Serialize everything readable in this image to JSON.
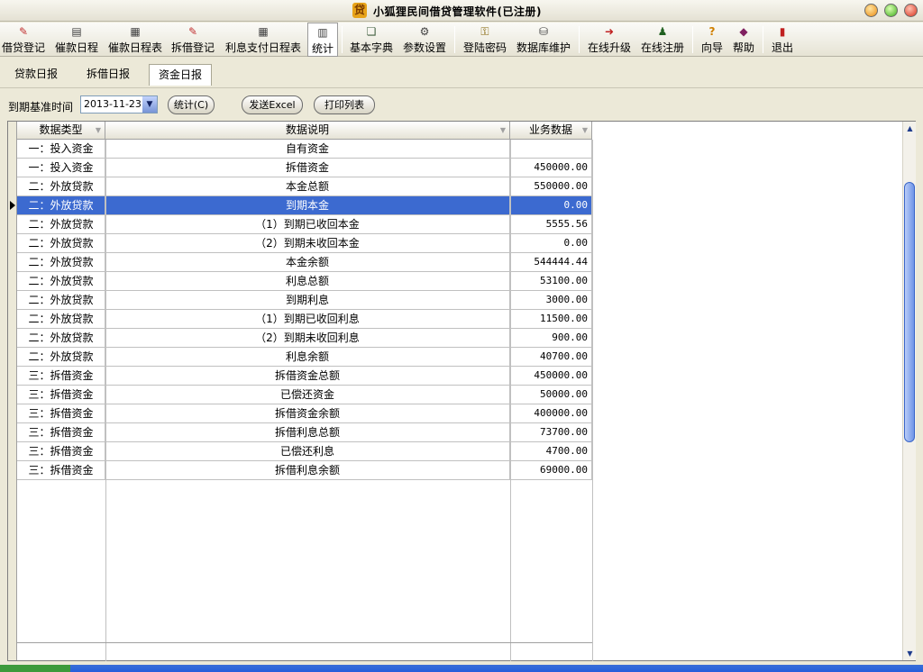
{
  "window": {
    "title": "小狐狸民间借贷管理软件(已注册)"
  },
  "toolbar": {
    "buttons": [
      {
        "label": "借贷登记",
        "icon": "loan-register-icon"
      },
      {
        "label": "催款日程",
        "icon": "calendar-icon"
      },
      {
        "label": "催款日程表",
        "icon": "schedule-table-icon"
      },
      {
        "label": "拆借登记",
        "icon": "borrow-register-icon"
      },
      {
        "label": "利息支付日程表",
        "icon": "interest-table-icon"
      },
      {
        "label": "统计",
        "icon": "statistics-icon"
      },
      {
        "label": "基本字典",
        "icon": "dictionary-icon"
      },
      {
        "label": "参数设置",
        "icon": "settings-icon"
      },
      {
        "label": "登陆密码",
        "icon": "key-icon"
      },
      {
        "label": "数据库维护",
        "icon": "database-icon"
      },
      {
        "label": "在线升级",
        "icon": "upgrade-icon"
      },
      {
        "label": "在线注册",
        "icon": "register-user-icon"
      },
      {
        "label": "向导",
        "icon": "help-question-icon"
      },
      {
        "label": "帮助",
        "icon": "help-book-icon"
      },
      {
        "label": "退出",
        "icon": "exit-icon"
      }
    ]
  },
  "tabs": [
    "贷款日报",
    "拆借日报",
    "资金日报"
  ],
  "filter": {
    "date_label": "到期基准时间",
    "date_value": "2013-11-23",
    "stat_button": "统计(C)",
    "excel_button": "发送Excel",
    "print_button": "打印列表"
  },
  "table": {
    "headers": [
      "数据类型",
      "数据说明",
      "业务数据"
    ],
    "rows": [
      {
        "type": "一：投入资金",
        "desc": "自有资金",
        "value": ""
      },
      {
        "type": "一：投入资金",
        "desc": "拆借资金",
        "value": "450000.00"
      },
      {
        "type": "二：外放贷款",
        "desc": "本金总额",
        "value": "550000.00"
      },
      {
        "type": "二：外放贷款",
        "desc": "到期本金",
        "value": "0.00"
      },
      {
        "type": "二：外放贷款",
        "desc": "（1）到期已收回本金",
        "value": "5555.56"
      },
      {
        "type": "二：外放贷款",
        "desc": "（2）到期未收回本金",
        "value": "0.00"
      },
      {
        "type": "二：外放贷款",
        "desc": "本金余额",
        "value": "544444.44"
      },
      {
        "type": "二：外放贷款",
        "desc": "利息总额",
        "value": "53100.00"
      },
      {
        "type": "二：外放贷款",
        "desc": "到期利息",
        "value": "3000.00"
      },
      {
        "type": "二：外放贷款",
        "desc": "（1）到期已收回利息",
        "value": "11500.00"
      },
      {
        "type": "二：外放贷款",
        "desc": "（2）到期未收回利息",
        "value": "900.00"
      },
      {
        "type": "二：外放贷款",
        "desc": "利息余额",
        "value": "40700.00"
      },
      {
        "type": "三：拆借资金",
        "desc": "拆借资金总额",
        "value": "450000.00"
      },
      {
        "type": "三：拆借资金",
        "desc": "已偿还资金",
        "value": "50000.00"
      },
      {
        "type": "三：拆借资金",
        "desc": "拆借资金余额",
        "value": "400000.00"
      },
      {
        "type": "三：拆借资金",
        "desc": "拆借利息总额",
        "value": "73700.00"
      },
      {
        "type": "三：拆借资金",
        "desc": "已偿还利息",
        "value": "4700.00"
      },
      {
        "type": "三：拆借资金",
        "desc": "拆借利息余额",
        "value": "69000.00"
      }
    ]
  },
  "colors": {
    "selection": "#3c6ad0",
    "window_bg": "#ece9d8"
  }
}
